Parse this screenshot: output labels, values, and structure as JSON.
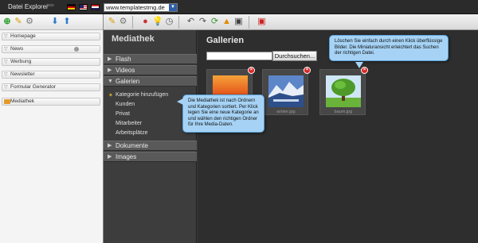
{
  "topbar": {
    "app_title": "Datei Explorer",
    "arrows": ">>>",
    "site_select_value": "www.templatestrng.de"
  },
  "explorer": {
    "tree": [
      {
        "label": "Homepage"
      },
      {
        "label": "News"
      },
      {
        "label": "Werbung"
      },
      {
        "label": "Newsletter"
      },
      {
        "label": "Formular Generator"
      },
      {
        "label": "Mediathek"
      }
    ]
  },
  "mediathek": {
    "title": "Mediathek",
    "categories": [
      "Flash",
      "Videos",
      "Galerien",
      "Dokumente",
      "Images"
    ],
    "gallery_items": [
      "Kategorie hinzufügen",
      "Kunden",
      "Privat",
      "Mitarbeiter",
      "Arbeitsplätze"
    ]
  },
  "gallery": {
    "title": "Gallerien",
    "search_button": "Durchsuchen...",
    "search_value": "",
    "images": [
      {
        "file": ""
      },
      {
        "file": "winter.jpg"
      },
      {
        "file": "baum.jpg"
      }
    ]
  },
  "tooltips": {
    "delete_hint": "Löschen Sie einfach durch einen Klick überflüssige Bilder. Die Miniaturansicht erleichtert das Suchen der richtigen Datei.",
    "category_hint": "Die Mediathek ist nach Ordnern und Kategorien sortiert. Per Klick legen Sie eine neue Kategorie an und wählen den richtigen Ordner für Ihre Media-Daten."
  },
  "colors": {
    "accent": "#2f5ea8",
    "tooltip": "#a6d3f5",
    "delete": "#dd2222"
  }
}
